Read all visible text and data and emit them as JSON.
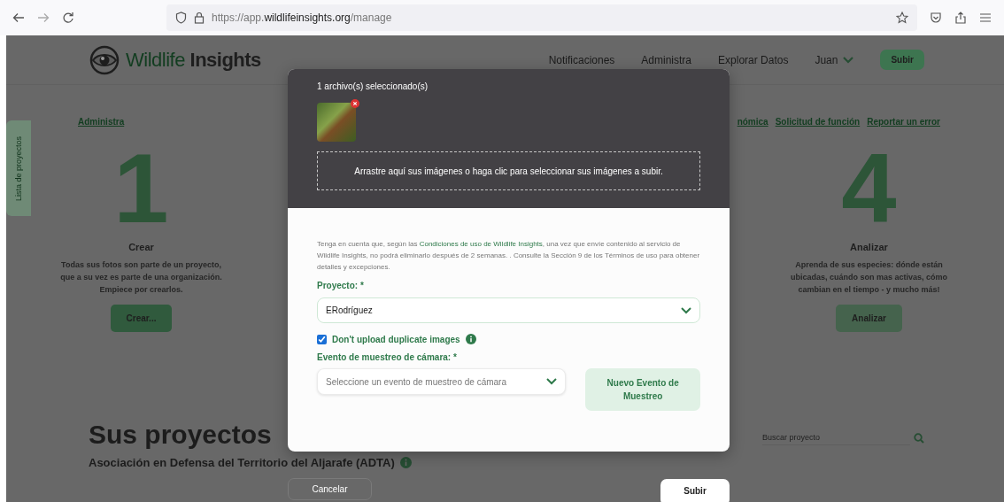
{
  "browser": {
    "url": "https://app.**wildlifeinsights.org**/manage"
  },
  "header": {
    "logo_light": "Wildlife",
    "logo_dark": "Insights",
    "nav": [
      "Notificaciones",
      "Administra",
      "Explorar Datos"
    ],
    "user": "Juan",
    "upload_button": "Subir"
  },
  "links": {
    "left": "Administra",
    "right": [
      "nómica",
      "Solicitud de función",
      "Reportar un error"
    ]
  },
  "side_tab": "Lista de proyectos",
  "steps": [
    {
      "number": "1",
      "title": "Crear",
      "description": "Todas sus fotos son parte de un proyecto, que a su vez es parte de una organización. Empiece por crearlos.",
      "button": "Crear..."
    },
    {
      "number": "4",
      "title": "Analizar",
      "description": "Aprenda de sus especies: dónde están ubicadas, cuándo son mas activas, cómo cambian en el tiempo - y mucho más!",
      "button": "Analizar"
    }
  ],
  "projects": {
    "heading": "Sus proyectos",
    "search_placeholder": "Buscar proyecto",
    "first_project": "Asociación en Defensa del Territorio del Aljarafe (ADTA)"
  },
  "modal": {
    "selected_text": "1 archivo(s) seleccionado(s)",
    "dropzone_text": "Arrastre aquí sus imágenes o haga clic para seleccionar sus imágenes a subir.",
    "notice_before": "Tenga en cuenta que, según las ",
    "notice_link": "Condiciones de uso de Wildlife Insights",
    "notice_after": ", una vez que envíe contenido al servicio de Wildlife Insights, no podrá eliminarlo después de 2 semanas. . Consulte la Sección 9 de los Términos de uso para obtener detalles y excepciones.",
    "project_label": "Proyecto: *",
    "project_value": "ERodríguez",
    "duplicate_checkbox": {
      "label": "Don't upload duplicate images",
      "checked": true
    },
    "event_label": "Evento de muestreo de cámara: *",
    "event_placeholder": "Seleccione un evento de muestreo de cámara",
    "new_event_button": "Nuevo Evento de Muestreo",
    "cancel_button": "Cancelar",
    "submit_button": "Subir"
  }
}
